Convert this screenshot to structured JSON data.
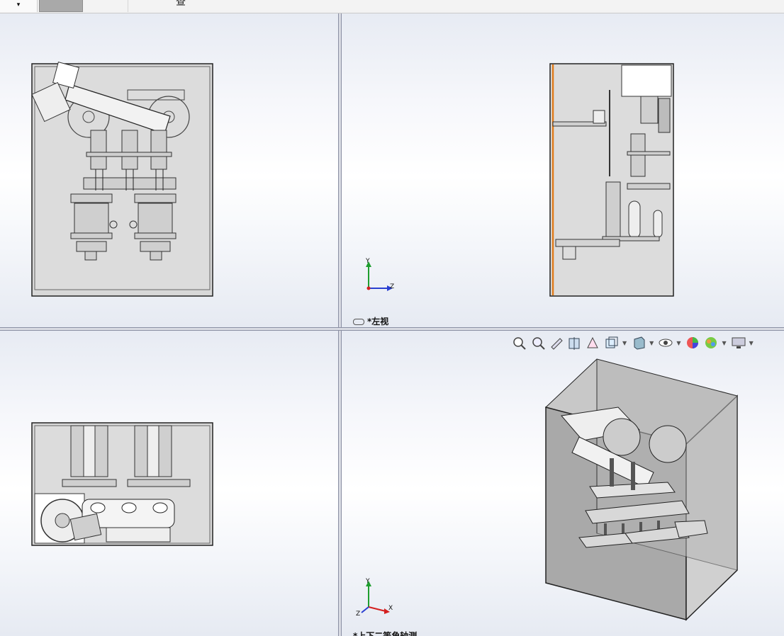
{
  "toolbar": {
    "dropdown_caret": "▾",
    "cut_text": "查"
  },
  "viewports": {
    "top_left": {
      "name": ""
    },
    "top_right": {
      "name": "*左视",
      "axis": {
        "y": "Y",
        "z": "Z"
      }
    },
    "bottom_left": {
      "name": ""
    },
    "bottom_right": {
      "name": "*上下二等角轴测",
      "axis": {
        "y": "Y",
        "x": "X",
        "z": "Z"
      }
    }
  },
  "heads_up_toolbar": {
    "icons": [
      "zoom-to-fit-icon",
      "zoom-to-area-icon",
      "previous-view-icon",
      "section-view-icon",
      "dynamic-annotation-icon",
      "view-orientation-icon",
      "display-style-icon",
      "hide-show-items-icon",
      "edit-appearance-icon",
      "apply-scene-icon",
      "view-settings-icon"
    ]
  },
  "colors": {
    "accent_orange": "#e07b1a",
    "axis_y": "#1e9e2e",
    "axis_x": "#d41f1f",
    "axis_z": "#2a3fd1"
  }
}
